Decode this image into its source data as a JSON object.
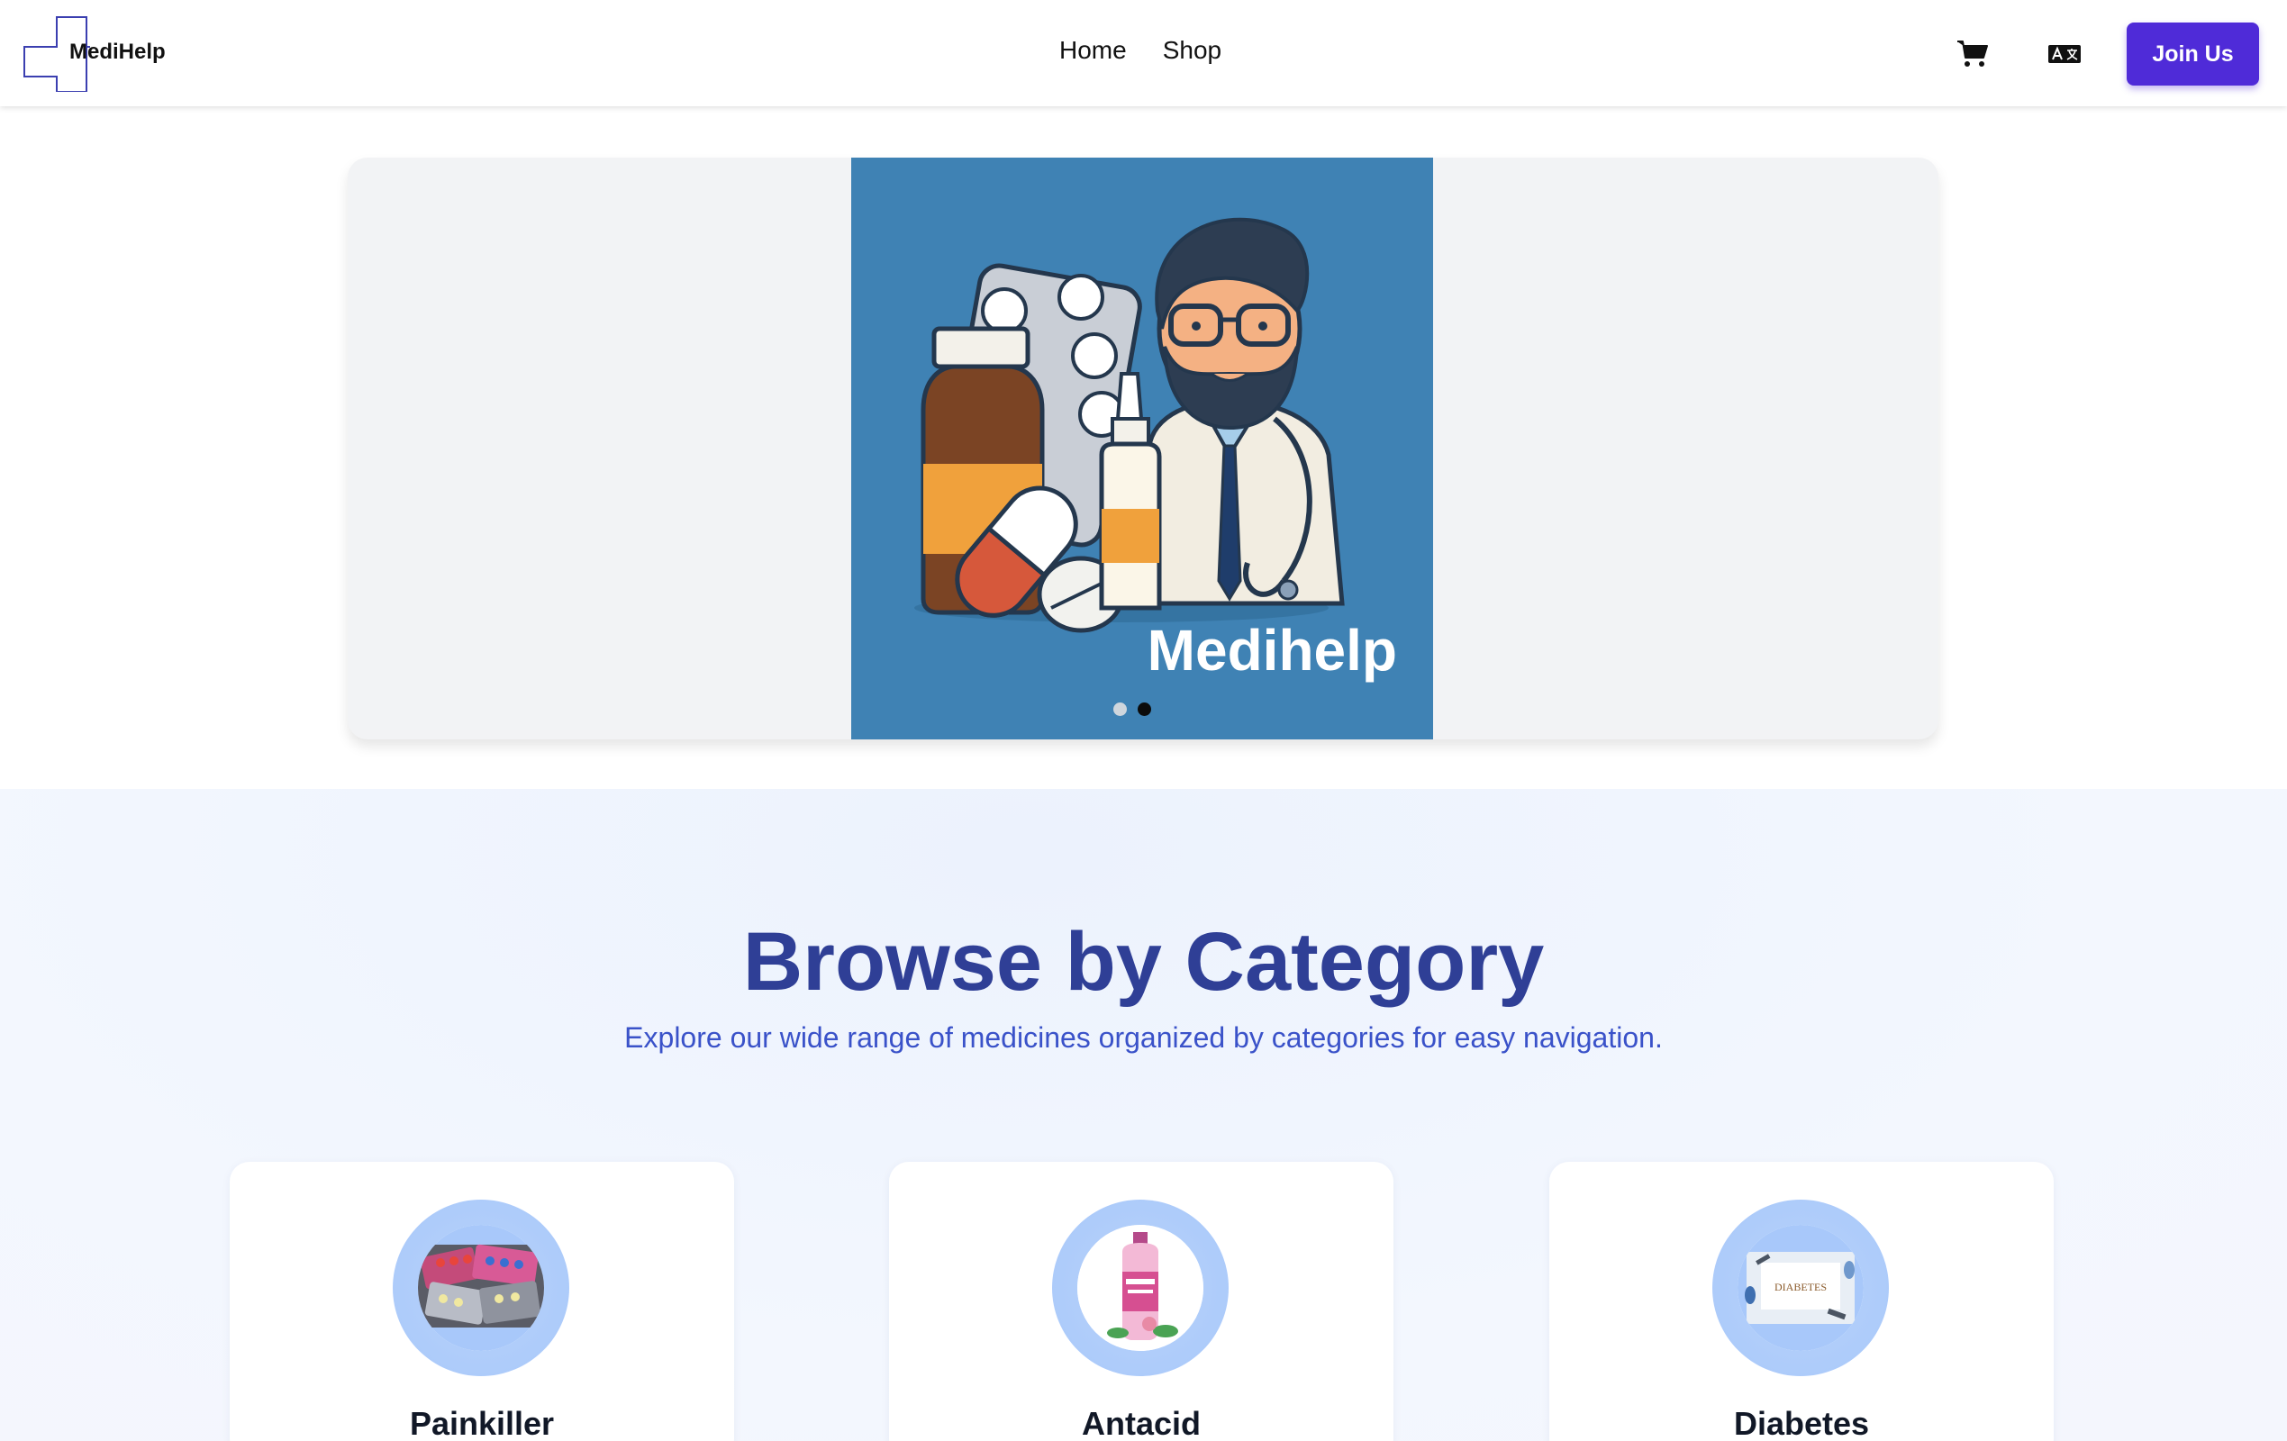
{
  "brand": {
    "name": "MediHelp"
  },
  "nav": {
    "links": [
      {
        "label": "Home"
      },
      {
        "label": "Shop"
      }
    ],
    "cart_icon": "cart-icon",
    "language_icon": "translate-icon",
    "join_label": "Join Us",
    "accent_color": "#4f2bd8"
  },
  "hero": {
    "caption": "Medihelp",
    "slide_bg": "#3f82b4",
    "slides_count": 2,
    "active_slide": 2
  },
  "category": {
    "title": "Browse by Category",
    "subtitle": "Explore our wide range of medicines organized by categories for easy navigation.",
    "title_color": "#2f3f96",
    "items": [
      {
        "label": "Painkiller"
      },
      {
        "label": "Antacid"
      },
      {
        "label": "Diabetes",
        "image_text": "DIABETES"
      }
    ]
  }
}
